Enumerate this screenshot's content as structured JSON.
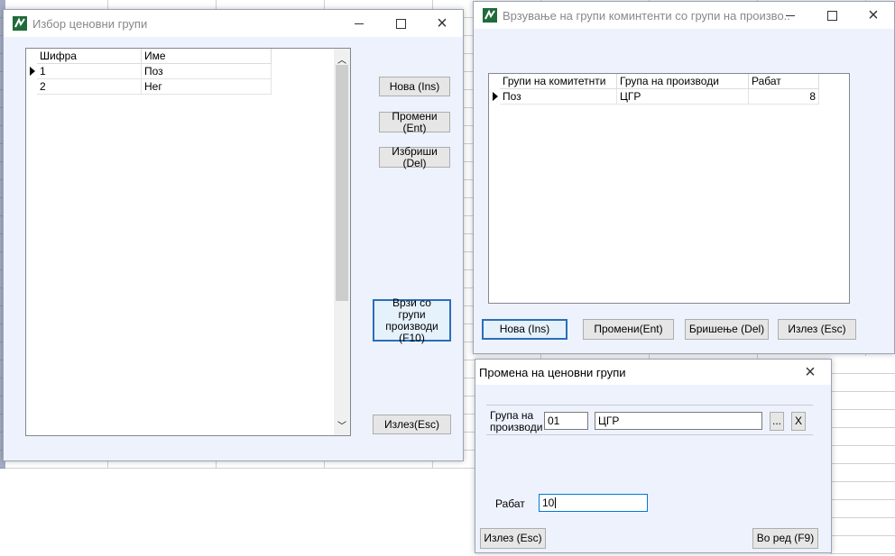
{
  "window_groups": {
    "title": "Избор ценовни групи",
    "columns": [
      "Шифра",
      "Име"
    ],
    "rows": [
      {
        "code": "1",
        "name": "Поз"
      },
      {
        "code": "2",
        "name": "Нег"
      }
    ],
    "buttons": {
      "new": "Нова (Ins)",
      "edit": "Промени (Ent)",
      "delete": "Избриши (Del)",
      "link": "Врзи со групи производи (F10)",
      "exit": "Излез(Esc)"
    }
  },
  "window_links": {
    "title": "Врзување на групи коминтенти со групи на произво...",
    "columns": [
      "Групи на комитетнти",
      "Група на производи",
      "Рабат"
    ],
    "rows": [
      {
        "client_group": "Поз",
        "product_group": "ЦГР",
        "discount": "8"
      }
    ],
    "buttons": {
      "new": "Нова (Ins)",
      "edit": "Промени(Ent)",
      "delete": "Бришење (Del)",
      "exit": "Излез (Esc)"
    }
  },
  "window_edit": {
    "title": "Промена на ценовни групи",
    "product_group_label": "Група на производи",
    "product_group_code": "01",
    "product_group_name": "ЦГР",
    "browse_label": "...",
    "clear_label": "X",
    "discount_label": "Рабат",
    "discount_value": "10",
    "buttons": {
      "exit": "Излез (Esc)",
      "ok": "Во ред (F9)"
    }
  },
  "icons": {
    "close": "×"
  }
}
